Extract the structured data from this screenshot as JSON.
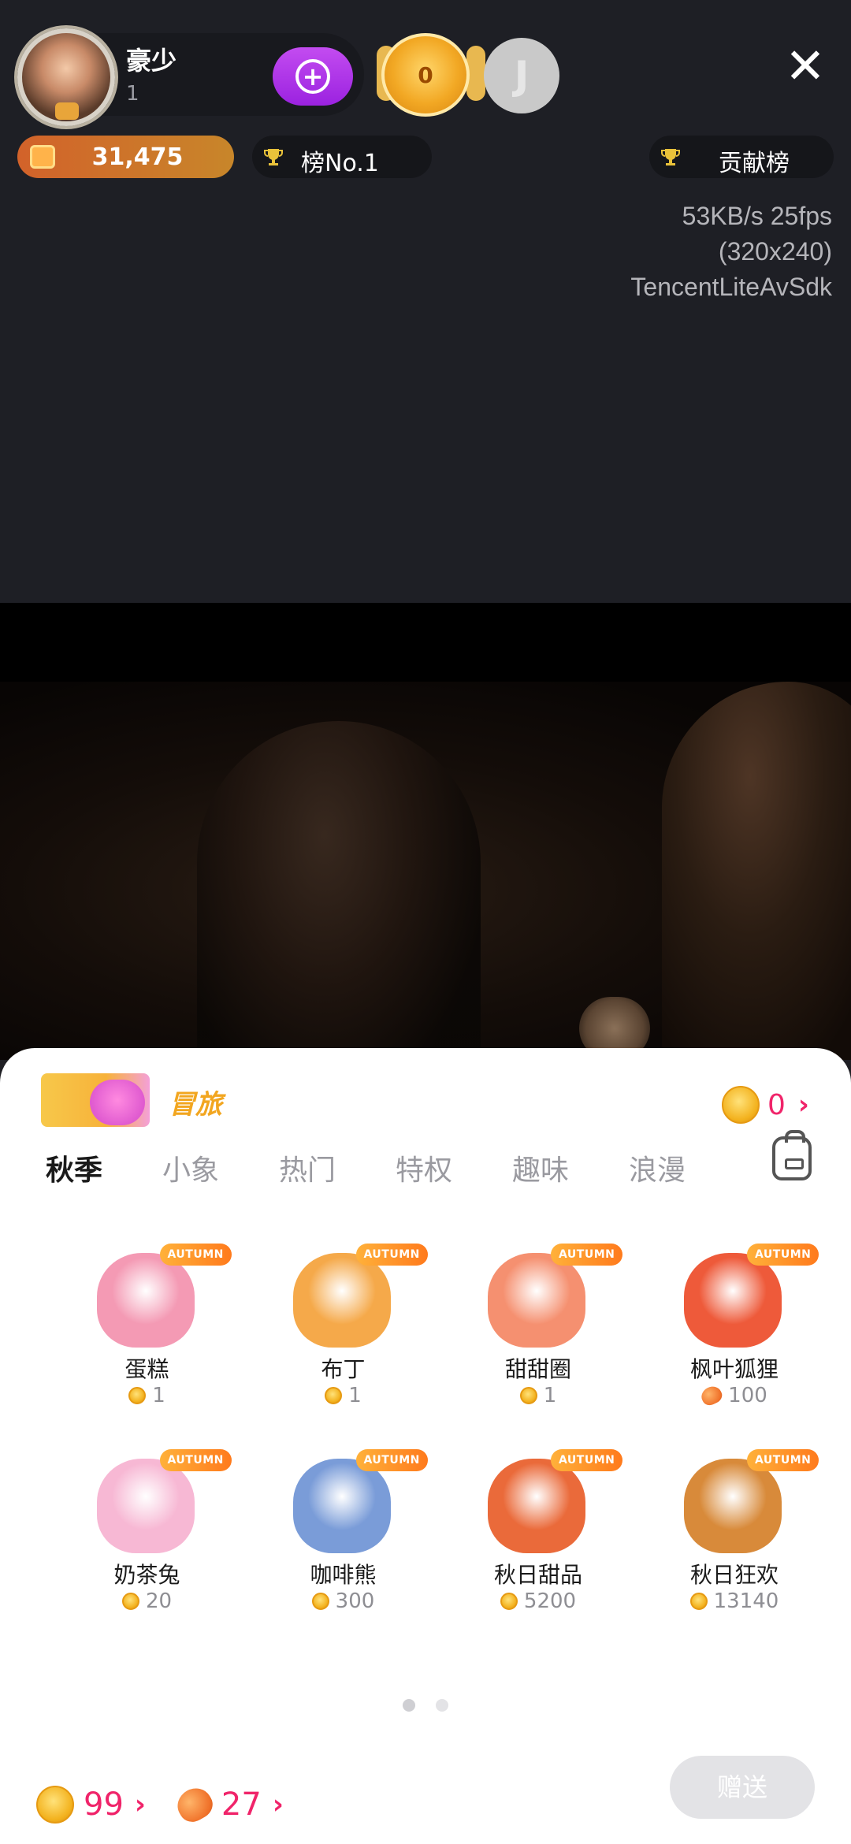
{
  "header": {
    "host_name": "豪少",
    "host_sub": "1",
    "medal_value": "0",
    "coins": "31,475",
    "rank_label": "榜No.1",
    "contrib_label": "贡献榜"
  },
  "stream_stats": {
    "line1": "53KB/s 25fps",
    "line2": "(320x240)",
    "line3": "TencentLiteAvSdk"
  },
  "panel": {
    "promo_text": "冒旅",
    "balance": "0",
    "tabs": [
      "秋季",
      "小象",
      "热门",
      "特权",
      "趣味",
      "浪漫"
    ],
    "gift_tag": "AUTUMN",
    "gifts": [
      {
        "name": "蛋糕",
        "price": "1",
        "currency": "coin",
        "color": "#f49ab4"
      },
      {
        "name": "布丁",
        "price": "1",
        "currency": "coin",
        "color": "#f5a94a"
      },
      {
        "name": "甜甜圈",
        "price": "1",
        "currency": "coin",
        "color": "#f59070"
      },
      {
        "name": "枫叶狐狸",
        "price": "100",
        "currency": "bean",
        "color": "#ee5a3a"
      },
      {
        "name": "奶茶兔",
        "price": "20",
        "currency": "coin",
        "color": "#f7b8d4"
      },
      {
        "name": "咖啡熊",
        "price": "300",
        "currency": "coin",
        "color": "#7a9cd8"
      },
      {
        "name": "秋日甜品",
        "price": "5200",
        "currency": "coin",
        "color": "#ea6a3a"
      },
      {
        "name": "秋日狂欢",
        "price": "13140",
        "currency": "coin",
        "color": "#d88a3a"
      }
    ],
    "coin_total": "99",
    "bean_total": "27",
    "send_label": "赠送"
  }
}
